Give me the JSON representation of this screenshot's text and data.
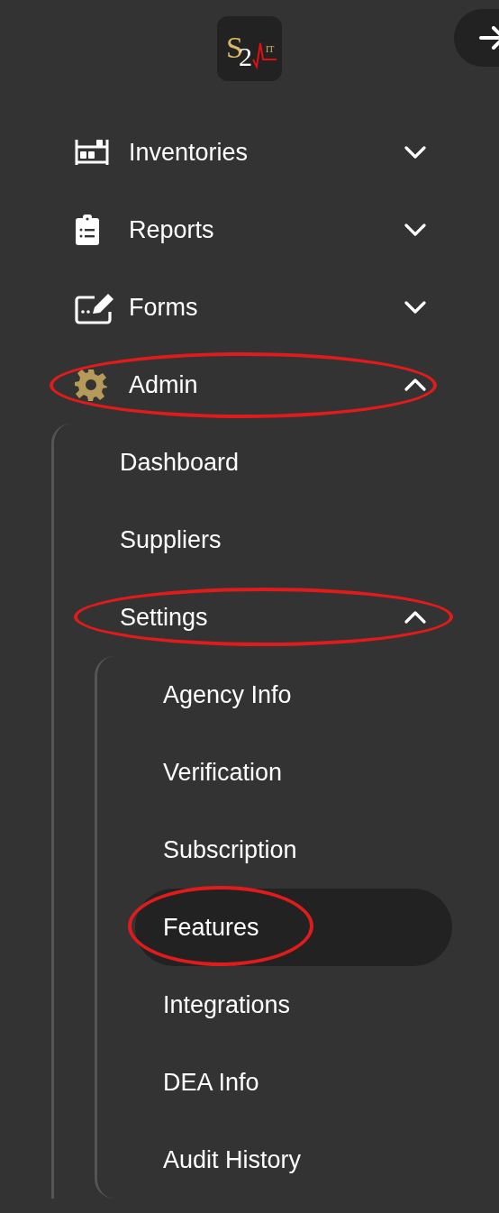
{
  "logo": {
    "letter": "S",
    "digit": "2",
    "suffix": "IT"
  },
  "nav": [
    {
      "label": "Inventories",
      "expanded": false,
      "active": false,
      "circled": false
    },
    {
      "label": "Reports",
      "expanded": false,
      "active": false,
      "circled": false
    },
    {
      "label": "Forms",
      "expanded": false,
      "active": false,
      "circled": false
    },
    {
      "label": "Admin",
      "expanded": true,
      "active": true,
      "circled": true,
      "children": [
        {
          "label": "Dashboard",
          "selected": false,
          "circled": false
        },
        {
          "label": "Suppliers",
          "selected": false,
          "circled": false
        },
        {
          "label": "Settings",
          "selected": false,
          "circled": true,
          "expanded": true,
          "children": [
            {
              "label": "Agency Info",
              "selected": false,
              "circled": false
            },
            {
              "label": "Verification",
              "selected": false,
              "circled": false
            },
            {
              "label": "Subscription",
              "selected": false,
              "circled": false
            },
            {
              "label": "Features",
              "selected": true,
              "circled": true
            },
            {
              "label": "Integrations",
              "selected": false,
              "circled": false
            },
            {
              "label": "DEA Info",
              "selected": false,
              "circled": false
            },
            {
              "label": "Audit History",
              "selected": false,
              "circled": false
            }
          ]
        }
      ]
    }
  ]
}
